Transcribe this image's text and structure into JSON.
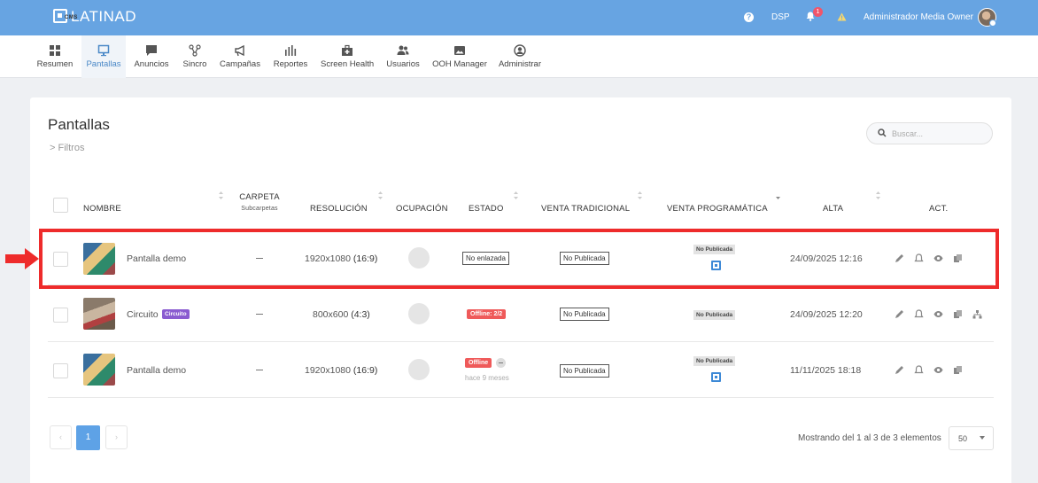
{
  "app": {
    "brand": "LATINAD",
    "brand_sub": "CMS",
    "help_icon": "help-circle-icon",
    "dsp_label": "DSP",
    "notifications_count": "1",
    "user_name": "Administrador Media Owner"
  },
  "nav": {
    "items": [
      {
        "label": "Resumen",
        "icon": "grid-icon"
      },
      {
        "label": "Pantallas",
        "icon": "monitor-icon",
        "active": true
      },
      {
        "label": "Anuncios",
        "icon": "chat-icon"
      },
      {
        "label": "Sincro",
        "icon": "share-nodes-icon"
      },
      {
        "label": "Campañas",
        "icon": "megaphone-icon"
      },
      {
        "label": "Reportes",
        "icon": "bar-chart-icon"
      },
      {
        "label": "Screen Health",
        "icon": "medkit-icon"
      },
      {
        "label": "Usuarios",
        "icon": "users-icon"
      },
      {
        "label": "OOH Manager",
        "icon": "image-icon"
      },
      {
        "label": "Administrar",
        "icon": "user-circle-icon"
      }
    ]
  },
  "page": {
    "title": "Pantallas",
    "filters_label": "Filtros",
    "search_placeholder": "Buscar..."
  },
  "table": {
    "headers": {
      "nombre": "NOMBRE",
      "carpeta": "CARPETA",
      "carpeta_sub": "Subcarpetas",
      "resolucion": "RESOLUCIÓN",
      "ocupacion": "OCUPACIÓN",
      "estado": "ESTADO",
      "venta_tradicional": "VENTA TRADICIONAL",
      "venta_programatica": "VENTA PROGRAMÁTICA",
      "alta": "ALTA",
      "act": "ACT."
    },
    "rows": [
      {
        "name": "Pantalla demo",
        "resolution": "1920x1080",
        "aspect": "(16:9)",
        "status": "No enlazada",
        "traditional": "No Publicada",
        "programmatic": "No Publicada",
        "created": "24/09/2025 12:16"
      },
      {
        "name": "Circuito",
        "badge": "Circuito",
        "resolution": "800x600",
        "aspect": "(4:3)",
        "status": "Offline: 2/2",
        "traditional": "No Publicada",
        "programmatic": "No Publicada",
        "created": "24/09/2025 12:20"
      },
      {
        "name": "Pantalla demo",
        "resolution": "1920x1080",
        "aspect": "(16:9)",
        "status": "Offline",
        "status_note": "hace 9 meses",
        "traditional": "No Publicada",
        "programmatic": "No Publicada",
        "created": "11/11/2025 18:18"
      }
    ]
  },
  "pagination": {
    "current_page": "1",
    "showing": "Mostrando del 1 al 3 de 3 elementos",
    "per_page": "50"
  },
  "colors": {
    "topbar": "#67a4e2",
    "highlight": "#ee2b2b",
    "offline": "#ef5a5a",
    "circuit_badge": "#8a5cd0"
  }
}
